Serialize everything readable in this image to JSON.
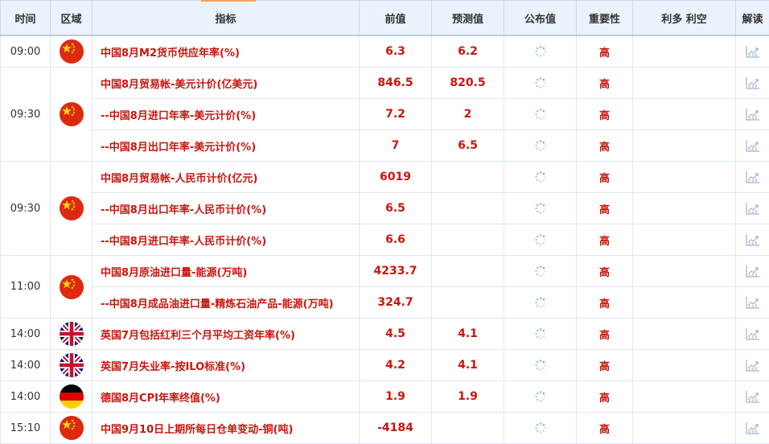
{
  "header": {
    "time": "时间",
    "region": "区域",
    "indicator": "指标",
    "previous": "前值",
    "forecast": "预测值",
    "actual": "公布值",
    "importance": "重要性",
    "impact": "利多 利空",
    "interpret": "解读"
  },
  "groups": [
    {
      "time": "09:00",
      "flag": "cn",
      "rows": [
        {
          "indicator": "中国8月M2货币供应年率(%)",
          "previous": "6.3",
          "forecast": "6.2",
          "importance": "高"
        }
      ]
    },
    {
      "time": "09:30",
      "flag": "cn",
      "rows": [
        {
          "indicator": "中国8月贸易帐-美元计价(亿美元)",
          "previous": "846.5",
          "forecast": "820.5",
          "importance": "高"
        },
        {
          "indicator": "--中国8月进口年率-美元计价(%)",
          "previous": "7.2",
          "forecast": "2",
          "importance": "高"
        },
        {
          "indicator": "--中国8月出口年率-美元计价(%)",
          "previous": "7",
          "forecast": "6.5",
          "importance": "高"
        }
      ]
    },
    {
      "time": "09:30",
      "flag": "cn",
      "rows": [
        {
          "indicator": "中国8月贸易帐-人民币计价(亿元)",
          "previous": "6019",
          "forecast": "",
          "importance": "高"
        },
        {
          "indicator": "--中国8月出口年率-人民币计价(%)",
          "previous": "6.5",
          "forecast": "",
          "importance": "高"
        },
        {
          "indicator": "--中国8月进口年率-人民币计价(%)",
          "previous": "6.6",
          "forecast": "",
          "importance": "高"
        }
      ]
    },
    {
      "time": "11:00",
      "flag": "cn",
      "rows": [
        {
          "indicator": "中国8月原油进口量-能源(万吨)",
          "previous": "4233.7",
          "forecast": "",
          "importance": "高"
        },
        {
          "indicator": "--中国8月成品油进口量-精炼石油产品-能源(万吨)",
          "previous": "324.7",
          "forecast": "",
          "importance": "高"
        }
      ]
    },
    {
      "time": "14:00",
      "flag": "uk",
      "rows": [
        {
          "indicator": "英国7月包括红利三个月平均工资年率(%)",
          "previous": "4.5",
          "forecast": "4.1",
          "importance": "高"
        }
      ]
    },
    {
      "time": "14:00",
      "flag": "uk",
      "rows": [
        {
          "indicator": "英国7月失业率-按ILO标准(%)",
          "previous": "4.2",
          "forecast": "4.1",
          "importance": "高"
        }
      ]
    },
    {
      "time": "14:00",
      "flag": "de",
      "rows": [
        {
          "indicator": "德国8月CPI年率终值(%)",
          "previous": "1.9",
          "forecast": "1.9",
          "importance": "高"
        }
      ]
    },
    {
      "time": "15:10",
      "flag": "cn",
      "rows": [
        {
          "indicator": "中国9月10日上期所每日仓单变动-铜(吨)",
          "previous": "-4184",
          "forecast": "",
          "importance": "高"
        }
      ]
    }
  ],
  "icons": {
    "pending": "loading-spinner-icon",
    "interpret": "chart-analysis-icon"
  },
  "colors": {
    "accent_red": "#c8160e",
    "header_bg": "#eaf2fb"
  }
}
